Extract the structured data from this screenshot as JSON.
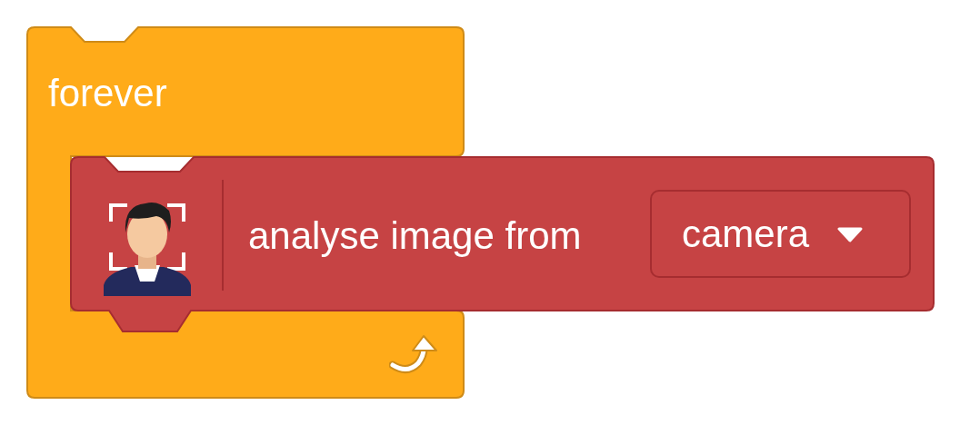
{
  "forever_block": {
    "label": "forever"
  },
  "sensing_block": {
    "label": "analyse image from",
    "dropdown": {
      "value": "camera"
    }
  }
}
